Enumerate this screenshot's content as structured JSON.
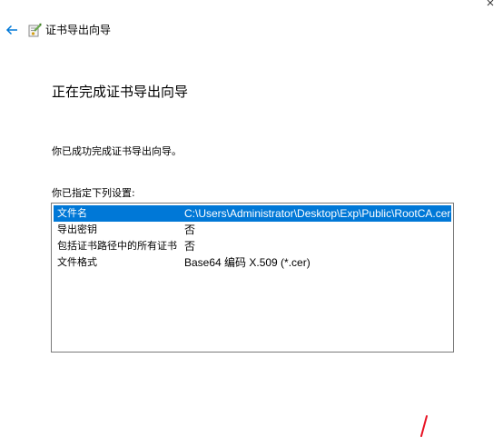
{
  "window": {
    "title": "证书导出向导"
  },
  "page": {
    "heading": "正在完成证书导出向导",
    "success_text": "你已成功完成证书导出向导。",
    "settings_label": "你已指定下列设置:"
  },
  "settings": {
    "rows": [
      {
        "name": "文件名",
        "value": "C:\\Users\\Administrator\\Desktop\\Exp\\Public\\RootCA.cer",
        "selected": true
      },
      {
        "name": "导出密钥",
        "value": "否",
        "selected": false
      },
      {
        "name": "包括证书路径中的所有证书",
        "value": "否",
        "selected": false
      },
      {
        "name": "文件格式",
        "value": "Base64 编码 X.509 (*.cer)",
        "selected": false
      }
    ]
  },
  "colors": {
    "selection": "#0078d7",
    "back_arrow": "#0078d7",
    "annotation_mark": "#e81123"
  },
  "icons": {
    "back": "back-arrow-icon",
    "wizard": "certificate-wizard-icon"
  }
}
